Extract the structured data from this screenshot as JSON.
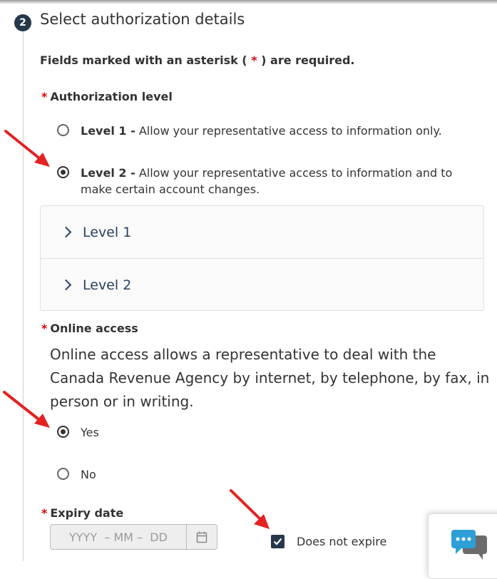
{
  "step": {
    "number": "2",
    "title": "Select authorization details"
  },
  "required_note": {
    "prefix": "Fields marked with an asterisk ( ",
    "asterisk": "*",
    "suffix": " ) are required."
  },
  "authorization_level": {
    "label": "Authorization level",
    "options": [
      {
        "strong": "Level 1 -",
        "text": " Allow your representative access to information only.",
        "checked": false
      },
      {
        "strong": "Level 2 -",
        "text": " Allow your representative access to information and to make certain account changes.",
        "checked": true
      }
    ]
  },
  "accordion": {
    "items": [
      "Level 1",
      "Level 2"
    ]
  },
  "online_access": {
    "label": "Online access",
    "description": "Online access allows a representative to deal with the Canada Revenue Agency by internet, by telephone, by fax, in person or in writing.",
    "options": [
      {
        "label": "Yes",
        "checked": true
      },
      {
        "label": "No",
        "checked": false
      }
    ]
  },
  "expiry": {
    "label": "Expiry date",
    "placeholder": "YYYY  – MM –  DD",
    "checkbox_label": "Does not expire",
    "checkbox_checked": true
  },
  "icons": {
    "step": "step-number-badge",
    "calendar": "calendar-icon",
    "chevron": "chevron-right-icon",
    "chat": "chat-icon",
    "annotation": "red-arrow-icon"
  },
  "colors": {
    "accent_dark": "#26374a",
    "link": "#284162",
    "required": "#d3080c",
    "annotation_arrow": "#e32222",
    "chat_blue": "#2e9fd6"
  }
}
